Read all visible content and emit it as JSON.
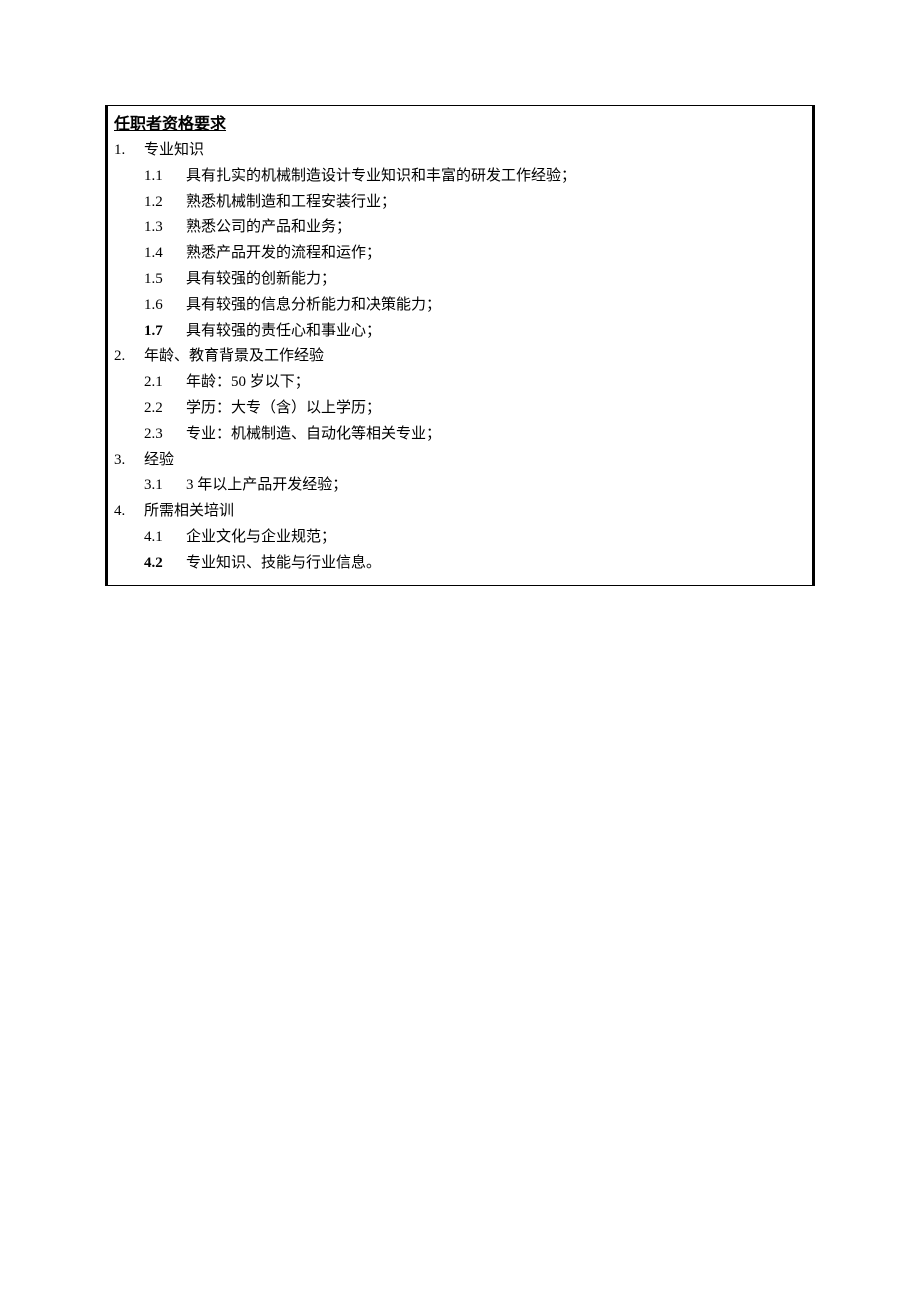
{
  "title": "任职者资格要求",
  "sections": [
    {
      "num": "1.",
      "label": "专业知识",
      "items": [
        {
          "num": "1.1",
          "text": "具有扎实的机械制造设计专业知识和丰富的研发工作经验；"
        },
        {
          "num": "1.2",
          "text": "熟悉机械制造和工程安装行业；"
        },
        {
          "num": "1.3",
          "text": "熟悉公司的产品和业务；"
        },
        {
          "num": "1.4",
          "text": "熟悉产品开发的流程和运作；"
        },
        {
          "num": "1.5",
          "text": "具有较强的创新能力；"
        },
        {
          "num": "1.6",
          "text": "具有较强的信息分析能力和决策能力；"
        },
        {
          "num": "1.7",
          "text": "具有较强的责任心和事业心；",
          "boldNum": true
        }
      ]
    },
    {
      "num": "2.",
      "label": "年龄、教育背景及工作经验",
      "items": [
        {
          "num": "2.1",
          "text": "年龄：50 岁以下；"
        },
        {
          "num": "2.2",
          "text": "学历：大专（含）以上学历；"
        },
        {
          "num": "2.3",
          "text": "专业：机械制造、自动化等相关专业；"
        }
      ]
    },
    {
      "num": "3.",
      "label": "经验",
      "items": [
        {
          "num": "3.1",
          "text": "3 年以上产品开发经验；"
        }
      ]
    },
    {
      "num": "4.",
      "label": "所需相关培训",
      "items": [
        {
          "num": "4.1",
          "text": "企业文化与企业规范；"
        },
        {
          "num": "4.2",
          "text": "专业知识、技能与行业信息。",
          "boldNum": true
        }
      ]
    }
  ]
}
